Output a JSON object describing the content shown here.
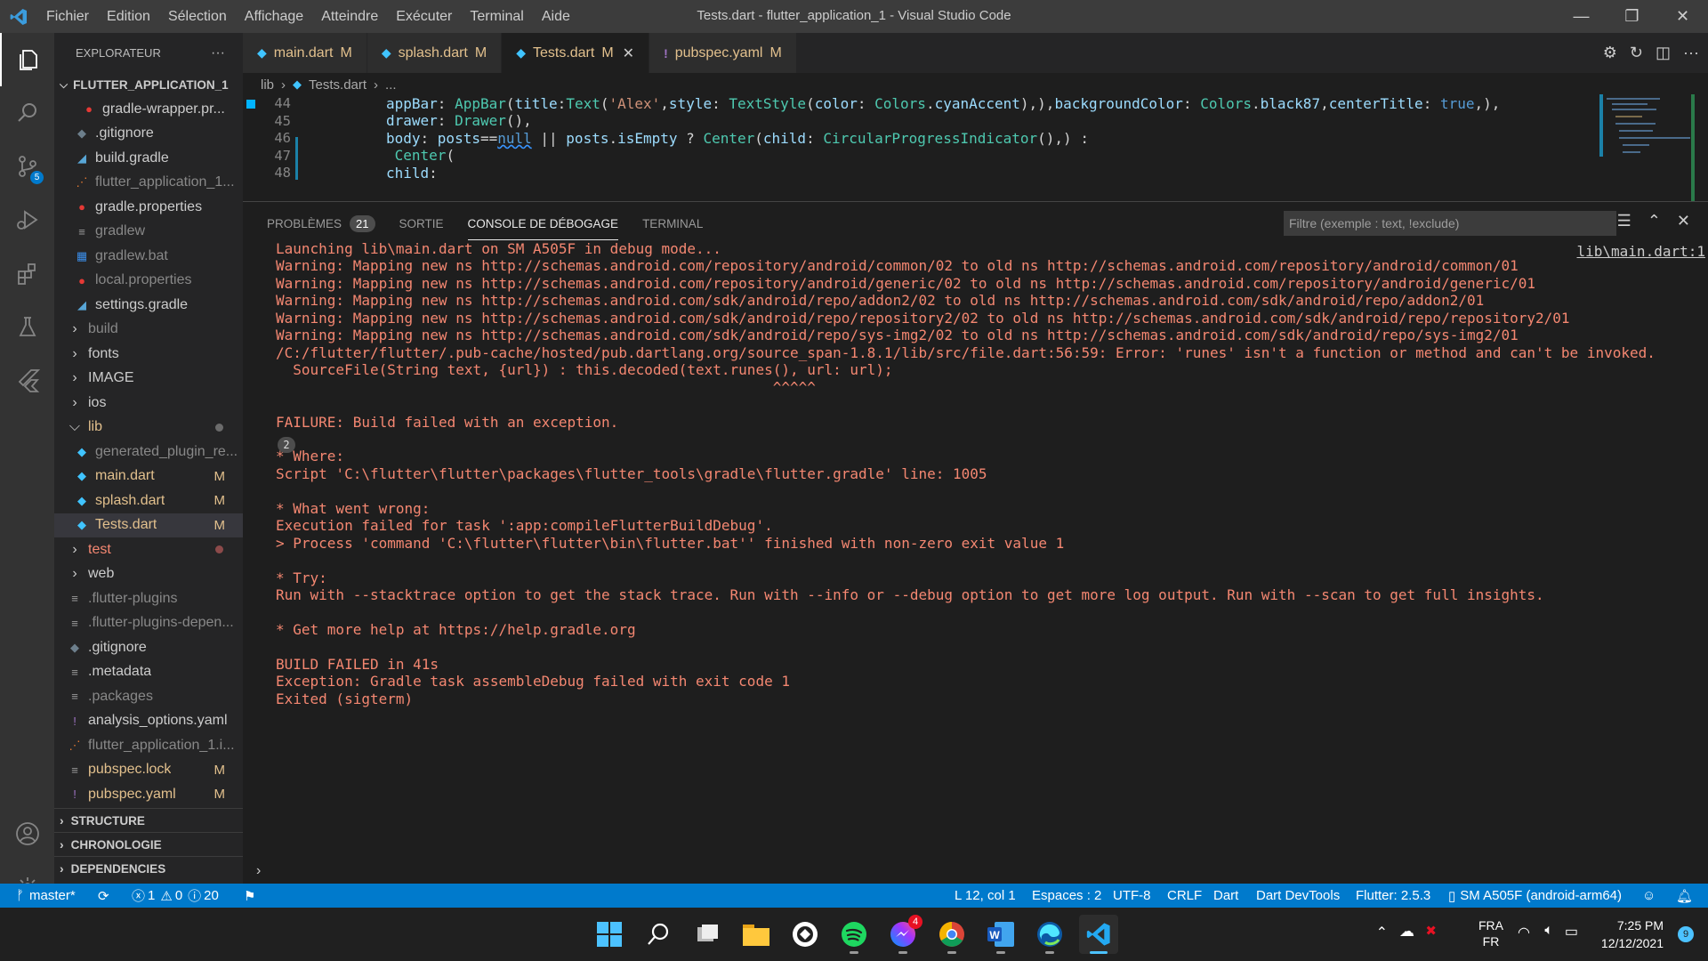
{
  "titlebar": {
    "menus": [
      "Fichier",
      "Edition",
      "Sélection",
      "Affichage",
      "Atteindre",
      "Exécuter",
      "Terminal",
      "Aide"
    ],
    "title": "Tests.dart - flutter_application_1 - Visual Studio Code"
  },
  "activitybar": {
    "scm_badge": "5"
  },
  "sidebar": {
    "header": "EXPLORATEUR",
    "more": "···",
    "root": "FLUTTER_APPLICATION_1",
    "items": [
      {
        "label": "gradle-wrapper.pr...",
        "icon": "gradle-wrapper-icon",
        "color": "#ccc",
        "indent": 2
      },
      {
        "label": ".gitignore",
        "icon": "gitignore-icon",
        "color": "#ccc",
        "indent": 1
      },
      {
        "label": "build.gradle",
        "icon": "gradle-elephant-icon",
        "color": "#ccc",
        "indent": 1
      },
      {
        "label": "flutter_application_1...",
        "icon": "rss-icon",
        "color": "#888",
        "indent": 1
      },
      {
        "label": "gradle.properties",
        "icon": "gradle-properties-icon",
        "color": "#ccc",
        "indent": 1
      },
      {
        "label": "gradlew",
        "icon": "file-lines-icon",
        "color": "#888",
        "indent": 1
      },
      {
        "label": "gradlew.bat",
        "icon": "windows-icon",
        "color": "#888",
        "indent": 1
      },
      {
        "label": "local.properties",
        "icon": "gradle-properties-icon",
        "color": "#888",
        "indent": 1
      },
      {
        "label": "settings.gradle",
        "icon": "gradle-elephant-icon",
        "color": "#ccc",
        "indent": 1
      },
      {
        "label": "build",
        "icon": "chevron-right-icon",
        "color": "#888",
        "indent": 0
      },
      {
        "label": "fonts",
        "icon": "chevron-right-icon",
        "color": "#ccc",
        "indent": 0
      },
      {
        "label": "IMAGE",
        "icon": "chevron-right-icon",
        "color": "#ccc",
        "indent": 0
      },
      {
        "label": "ios",
        "icon": "chevron-right-icon",
        "color": "#ccc",
        "indent": 0
      },
      {
        "label": "lib",
        "icon": "chevron-down-icon",
        "color": "#e2c08d",
        "indent": 0
      },
      {
        "label": "generated_plugin_re...",
        "icon": "dart-icon",
        "color": "#888",
        "indent": 1
      },
      {
        "label": "main.dart",
        "icon": "dart-icon",
        "color": "#e2c08d",
        "indent": 1,
        "badge": "M"
      },
      {
        "label": "splash.dart",
        "icon": "dart-icon",
        "color": "#e2c08d",
        "indent": 1,
        "badge": "M"
      },
      {
        "label": "Tests.dart",
        "icon": "dart-icon",
        "color": "#e2c08d",
        "indent": 1,
        "badge": "M",
        "selected": true
      },
      {
        "label": "test",
        "icon": "chevron-right-icon",
        "color": "#f48771",
        "indent": 0
      },
      {
        "label": "web",
        "icon": "chevron-right-icon",
        "color": "#ccc",
        "indent": 0
      },
      {
        "label": ".flutter-plugins",
        "icon": "file-lines-icon",
        "color": "#888",
        "indent": 0
      },
      {
        "label": ".flutter-plugins-depen...",
        "icon": "file-lines-icon",
        "color": "#888",
        "indent": 0
      },
      {
        "label": ".gitignore",
        "icon": "gitignore-icon",
        "color": "#ccc",
        "indent": 0
      },
      {
        "label": ".metadata",
        "icon": "file-lines-icon",
        "color": "#ccc",
        "indent": 0
      },
      {
        "label": ".packages",
        "icon": "file-lines-icon",
        "color": "#888",
        "indent": 0
      },
      {
        "label": "analysis_options.yaml",
        "icon": "yaml-icon",
        "color": "#ccc",
        "indent": 0
      },
      {
        "label": "flutter_application_1.i...",
        "icon": "rss-icon",
        "color": "#888",
        "indent": 0
      },
      {
        "label": "pubspec.lock",
        "icon": "file-lines-icon",
        "color": "#e2c08d",
        "indent": 0,
        "badge": "M"
      },
      {
        "label": "pubspec.yaml",
        "icon": "yaml-icon",
        "color": "#e2c08d",
        "indent": 0,
        "badge": "M"
      }
    ],
    "sections": [
      "STRUCTURE",
      "CHRONOLOGIE",
      "DEPENDENCIES"
    ]
  },
  "tabs": [
    {
      "label": "main.dart",
      "mod": "M",
      "icon": "dart-icon",
      "active": false
    },
    {
      "label": "splash.dart",
      "mod": "M",
      "icon": "dart-icon",
      "active": false
    },
    {
      "label": "Tests.dart",
      "mod": "M",
      "icon": "dart-icon",
      "active": true
    },
    {
      "label": "pubspec.yaml",
      "mod": "M",
      "icon": "yaml-icon",
      "active": false
    }
  ],
  "breadcrumb": [
    "lib",
    "›",
    "Tests.dart",
    "›",
    "..."
  ],
  "editor": {
    "lines": [
      {
        "num": "44",
        "tokens": [
          [
            "k2",
            "appBar"
          ],
          [
            "k5",
            ": "
          ],
          [
            "k1",
            "AppBar"
          ],
          [
            "k5",
            "("
          ],
          [
            "k2",
            "title"
          ],
          [
            "k5",
            ":"
          ],
          [
            "k1",
            "Text"
          ],
          [
            "k5",
            "("
          ],
          [
            "k3",
            "'Alex'"
          ],
          [
            "k5",
            ","
          ],
          [
            "k2",
            "style"
          ],
          [
            "k5",
            ": "
          ],
          [
            "k1",
            "TextStyle"
          ],
          [
            "k5",
            "("
          ],
          [
            "k2",
            "color"
          ],
          [
            "k5",
            ": "
          ],
          [
            "k1",
            "Colors"
          ],
          [
            "k5",
            "."
          ],
          [
            "k2",
            "cyanAccent"
          ],
          [
            "k5",
            "),),"
          ],
          [
            "k2",
            "backgroundColor"
          ],
          [
            "k5",
            ": "
          ],
          [
            "k1",
            "Colors"
          ],
          [
            "k5",
            "."
          ],
          [
            "k2",
            "black87"
          ],
          [
            "k5",
            ","
          ],
          [
            "k2",
            "centerTitle"
          ],
          [
            "k5",
            ": "
          ],
          [
            "k4",
            "true"
          ],
          [
            "k5",
            ",),"
          ]
        ]
      },
      {
        "num": "45",
        "tokens": [
          [
            "k2",
            "drawer"
          ],
          [
            "k5",
            ": "
          ],
          [
            "k1",
            "Drawer"
          ],
          [
            "k5",
            "(),"
          ]
        ]
      },
      {
        "num": "46",
        "tokens": [
          [
            "k2",
            "body"
          ],
          [
            "k5",
            ": "
          ],
          [
            "k2",
            "posts"
          ],
          [
            "k5",
            "=="
          ],
          [
            "k4",
            "null"
          ],
          [
            "k5",
            " || "
          ],
          [
            "k2",
            "posts"
          ],
          [
            "k5",
            "."
          ],
          [
            "k2",
            "isEmpty"
          ],
          [
            "k5",
            " ? "
          ],
          [
            "k1",
            "Center"
          ],
          [
            "k5",
            "("
          ],
          [
            "k2",
            "child"
          ],
          [
            "k5",
            ": "
          ],
          [
            "k1",
            "CircularProgressIndicator"
          ],
          [
            "k5",
            "(),) :"
          ]
        ]
      },
      {
        "num": "47",
        "tokens": [
          [
            "k5",
            " "
          ],
          [
            "k1",
            "Center"
          ],
          [
            "k5",
            "("
          ]
        ]
      },
      {
        "num": "48",
        "tokens": [
          [
            "k2",
            "child"
          ],
          [
            "k5",
            ":"
          ]
        ]
      }
    ]
  },
  "panel": {
    "tabs": [
      {
        "label": "PROBLÈMES",
        "count": "21"
      },
      {
        "label": "SORTIE"
      },
      {
        "label": "CONSOLE DE DÉBOGAGE",
        "active": true
      },
      {
        "label": "TERMINAL"
      }
    ],
    "filter_placeholder": "Filtre (exemple : text, !exclude)",
    "source_link": "lib\\main.dart:1",
    "repeat_count": "2",
    "prompt": "›",
    "lines": [
      "Launching lib\\main.dart on SM A505F in debug mode...",
      "Warning: Mapping new ns http://schemas.android.com/repository/android/common/02 to old ns http://schemas.android.com/repository/android/common/01",
      "Warning: Mapping new ns http://schemas.android.com/repository/android/generic/02 to old ns http://schemas.android.com/repository/android/generic/01",
      "Warning: Mapping new ns http://schemas.android.com/sdk/android/repo/addon2/02 to old ns http://schemas.android.com/sdk/android/repo/addon2/01",
      "Warning: Mapping new ns http://schemas.android.com/sdk/android/repo/repository2/02 to old ns http://schemas.android.com/sdk/android/repo/repository2/01",
      "Warning: Mapping new ns http://schemas.android.com/sdk/android/repo/sys-img2/02 to old ns http://schemas.android.com/sdk/android/repo/sys-img2/01",
      "/C:/flutter/flutter/.pub-cache/hosted/pub.dartlang.org/source_span-1.8.1/lib/src/file.dart:56:59: Error: 'runes' isn't a function or method and can't be invoked.",
      "  SourceFile(String text, {url}) : this.decoded(text.runes(), url: url);",
      "                                                          ^^^^^",
      "",
      "FAILURE: Build failed with an exception.",
      "",
      "* Where:",
      "Script 'C:\\flutter\\flutter\\packages\\flutter_tools\\gradle\\flutter.gradle' line: 1005",
      "",
      "* What went wrong:",
      "Execution failed for task ':app:compileFlutterBuildDebug'.",
      "> Process 'command 'C:\\flutter\\flutter\\bin\\flutter.bat'' finished with non-zero exit value 1",
      "",
      "* Try:",
      "Run with --stacktrace option to get the stack trace. Run with --info or --debug option to get more log output. Run with --scan to get full insights.",
      "",
      "* Get more help at https://help.gradle.org",
      "",
      "BUILD FAILED in 41s",
      "Exception: Gradle task assembleDebug failed with exit code 1",
      "Exited (sigterm)"
    ]
  },
  "statusbar": {
    "branch": "master*",
    "errors": "1",
    "warnings": "0",
    "infos": "20",
    "position": "L 12, col 1",
    "spaces": "Espaces : 2",
    "encoding": "UTF-8",
    "eol": "CRLF",
    "language": "Dart",
    "devtools": "Dart DevTools",
    "flutter": "Flutter: 2.5.3",
    "device": "SM A505F (android-arm64)"
  },
  "taskbar": {
    "messenger_badge": "4",
    "lang_top": "FRA",
    "lang_bottom": "FR",
    "time": "7:25 PM",
    "date": "12/12/2021",
    "notif_count": "9"
  },
  "colors": {
    "accent": "#007acc",
    "error_text": "#f48771",
    "modified": "#e2c08d"
  }
}
